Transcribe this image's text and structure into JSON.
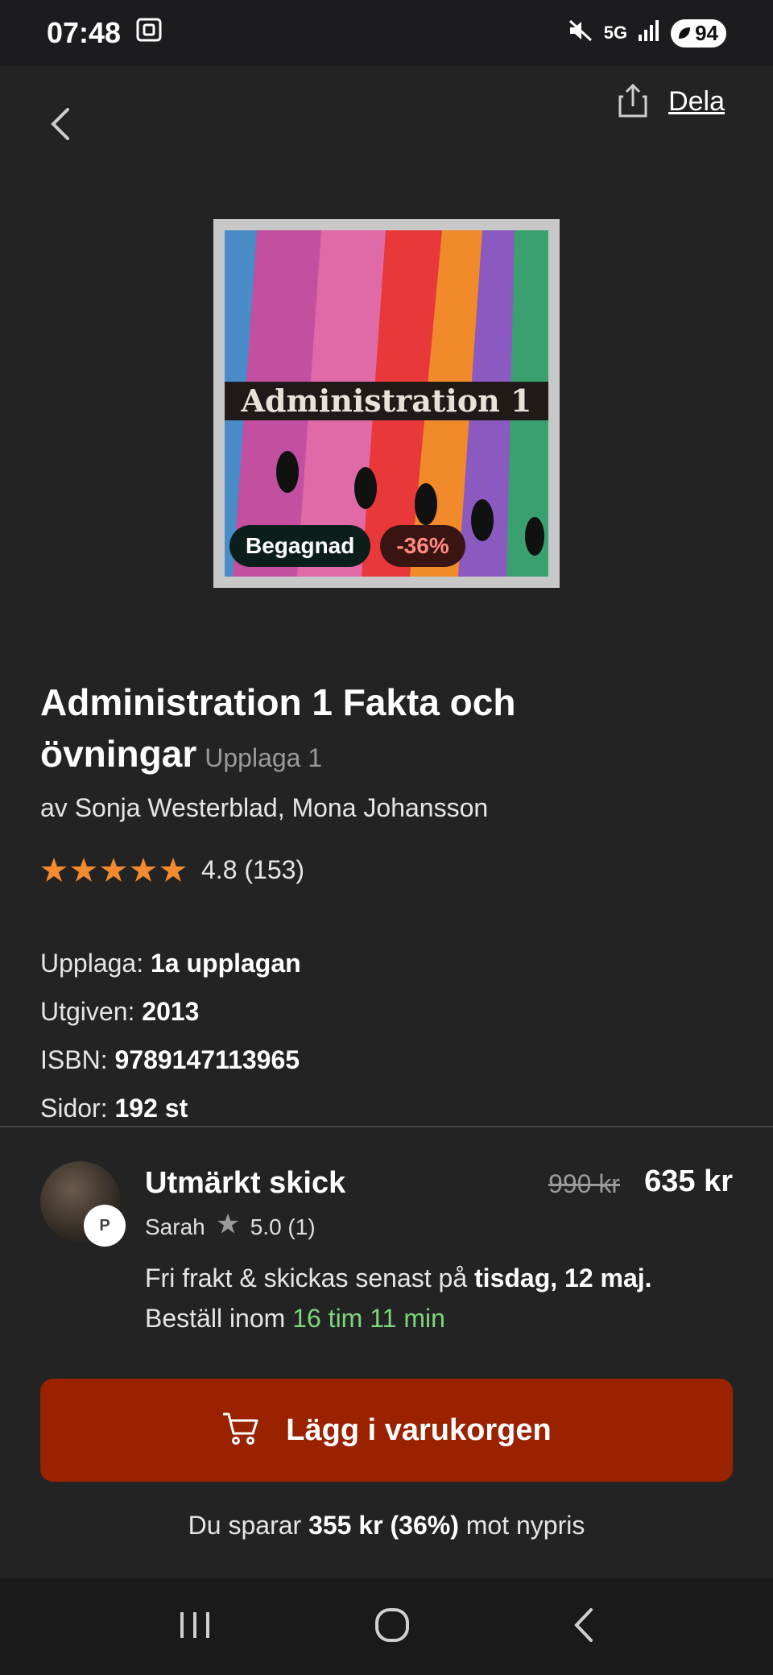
{
  "status_bar": {
    "time": "07:48",
    "network": "5G",
    "battery": "94"
  },
  "header": {
    "share_label": "Dela"
  },
  "cover": {
    "title_text": "Administration 1",
    "badge_used": "Begagnad",
    "badge_discount": "-36%"
  },
  "product": {
    "title": "Administration 1 Fakta och övningar",
    "edition_short": "Upplaga 1",
    "authors": "av Sonja Westerblad, Mona Johansson",
    "rating_text": "4.8 (153)",
    "rating_value": 4.8,
    "details": [
      {
        "label": "Upplaga:",
        "value": "1a upplagan"
      },
      {
        "label": "Utgiven:",
        "value": "2013"
      },
      {
        "label": "ISBN:",
        "value": "9789147113965"
      },
      {
        "label": "Sidor:",
        "value": "192 st"
      }
    ]
  },
  "offer": {
    "condition": "Utmärkt skick",
    "seller_name": "Sarah",
    "seller_rating": "5.0 (1)",
    "price_old": "990 kr",
    "price_new": "635 kr",
    "shipping_prefix": "Fri frakt & skickas senast på",
    "shipping_date": "tisdag, 12 maj.",
    "order_prefix": "Beställ inom",
    "order_time": "16 tim 11 min",
    "cart_button": "Lägg i varukorgen",
    "savings_prefix": "Du sparar",
    "savings_amount": "355 kr (36%)",
    "savings_suffix": "mot nypris"
  },
  "colors": {
    "background": "#232323",
    "accent_button": "#9a2200",
    "star": "#f28a30",
    "countdown": "#7ed57e"
  }
}
